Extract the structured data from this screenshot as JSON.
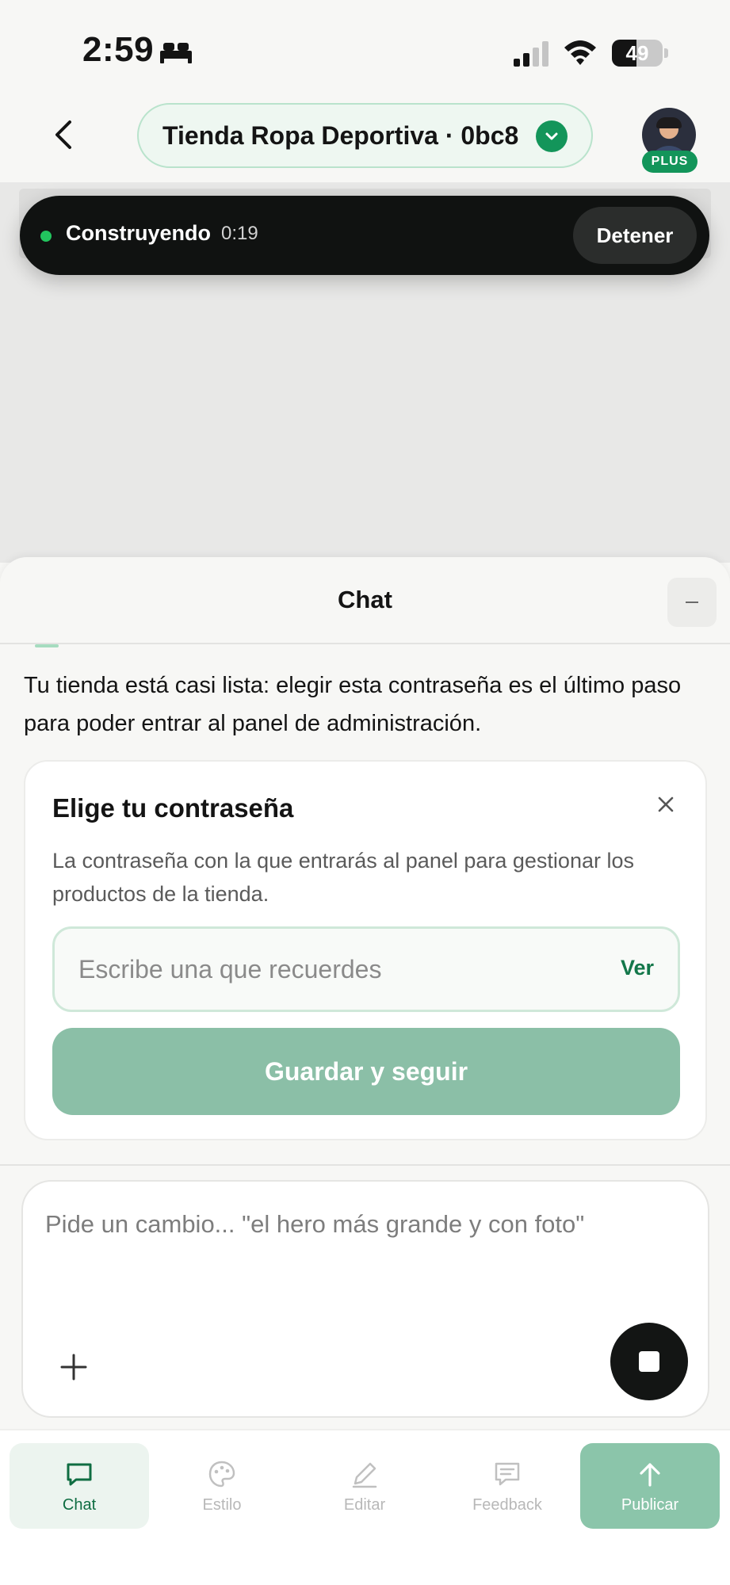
{
  "status_bar": {
    "time": "2:59",
    "battery_text": "49",
    "battery_level": 0.49,
    "icons": [
      "sleep-icon",
      "signal-icon",
      "wifi-icon",
      "battery-icon"
    ]
  },
  "header": {
    "project_name": "Tienda Ropa Deportiva · 0bc8",
    "plan_badge": "PLUS",
    "icons": [
      "back-arrow-icon",
      "chevron-down-icon",
      "avatar"
    ]
  },
  "build_bar": {
    "status": "Construyendo",
    "timer": "0:19",
    "stop_label": "Detener",
    "dot_color": "#22c55e"
  },
  "chat": {
    "title": "Chat",
    "assistant_message": "Tu tienda está casi lista: elegir esta contraseña es el último paso para poder entrar al panel de administración."
  },
  "password_card": {
    "title": "Elige tu contraseña",
    "description": "La contraseña con la que entrarás al panel para gestionar los productos de la tienda.",
    "input_value": "",
    "input_placeholder": "Escribe una que recuerdes",
    "show_label": "Ver",
    "save_label": "Guardar y seguir"
  },
  "composer": {
    "placeholder": "Pide un cambio... \"el hero más grande y con foto\""
  },
  "bottom_nav": {
    "items": [
      {
        "label": "Chat",
        "icon": "chat-icon",
        "active": true
      },
      {
        "label": "Estilo",
        "icon": "palette-icon",
        "active": false
      },
      {
        "label": "Editar",
        "icon": "pencil-icon",
        "active": false
      },
      {
        "label": "Feedback",
        "icon": "feedback-icon",
        "active": false
      },
      {
        "label": "Publicar",
        "icon": "arrow-up-icon",
        "active": false
      }
    ]
  },
  "colors": {
    "brand_green": "#13955a",
    "pill_border": "#b9e3cc",
    "button_disabled_green": "#8bbfa7",
    "publish_green": "#8bc5aa",
    "build_bar_bg": "#101211"
  }
}
